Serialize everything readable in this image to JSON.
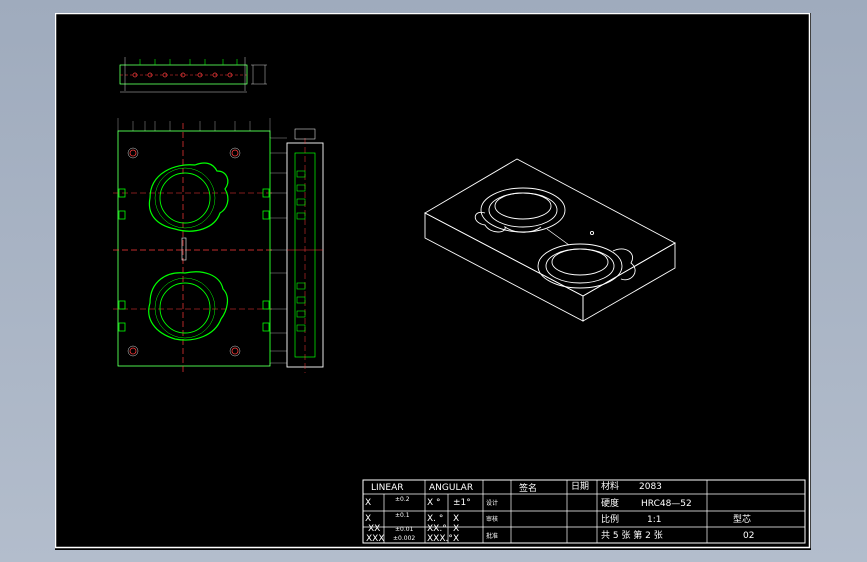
{
  "title_block": {
    "linear_header": "LINEAR",
    "angular_header": "ANGULAR",
    "sign_header": "签名",
    "date_header": "日期",
    "material_label": "材料",
    "material_value": "2083",
    "hardness_label": "硬度",
    "hardness_value": "HRC48—52",
    "scale_label": "比例",
    "scale_value": "1:1",
    "part_name": "型芯",
    "drawing_no": "02",
    "sheet_info": "共 5  张  第 2  张",
    "role_design": "设计",
    "role_review": "审核",
    "role_approve": "批准",
    "tol_rows": [
      {
        "lin": "X",
        "lin_tol": "±0.2",
        "ang": "X °",
        "ang_tol": "±1°"
      },
      {
        "lin": "X",
        "lin_tol": "±0.1",
        "ang": "X. °",
        "ang_tol": "X"
      },
      {
        "lin": "XX",
        "lin_tol": "±0.01",
        "ang": "XX.°",
        "ang_tol": "X"
      },
      {
        "lin": "XXX",
        "lin_tol": "±0.002",
        "ang": "XXX.°",
        "ang_tol": "X"
      }
    ]
  },
  "colors": {
    "background": "#000000",
    "outline": "#ffffff",
    "geometry": "#00ff00",
    "hidden": "#ff3b3b",
    "dimension": "#ffff00",
    "center": "#ff00ff"
  }
}
